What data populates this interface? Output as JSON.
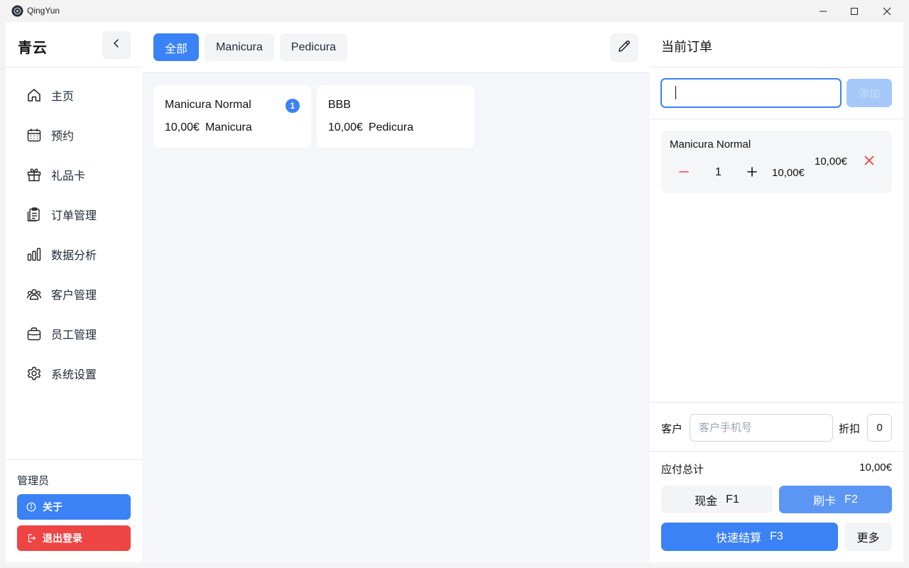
{
  "window": {
    "title": "QingYun"
  },
  "sidebar": {
    "brand": "青云",
    "items": [
      {
        "label": "主页",
        "icon": "home-icon"
      },
      {
        "label": "预约",
        "icon": "calendar-icon"
      },
      {
        "label": "礼品卡",
        "icon": "gift-icon"
      },
      {
        "label": "订单管理",
        "icon": "clipboard-icon"
      },
      {
        "label": "数据分析",
        "icon": "bar-chart-icon"
      },
      {
        "label": "客户管理",
        "icon": "users-icon"
      },
      {
        "label": "员工管理",
        "icon": "briefcase-icon"
      },
      {
        "label": "系统设置",
        "icon": "gear-icon"
      }
    ],
    "role": "管理员",
    "about_label": "关于",
    "logout_label": "退出登录"
  },
  "main": {
    "tabs": [
      {
        "label": "全部",
        "active": true
      },
      {
        "label": "Manicura",
        "active": false
      },
      {
        "label": "Pedicura",
        "active": false
      }
    ],
    "products": [
      {
        "name": "Manicura Normal",
        "price": "10,00€",
        "category": "Manicura",
        "count": "1"
      },
      {
        "name": "BBB",
        "price": "10,00€",
        "category": "Pedicura",
        "count": ""
      }
    ]
  },
  "order": {
    "title": "当前订单",
    "code_value": "",
    "add_label": "添加",
    "items": [
      {
        "name": "Manicura Normal",
        "qty": "1",
        "unit_price": "10,00€",
        "line_total": "10,00€"
      }
    ],
    "customer_label": "客户",
    "customer_placeholder": "客户手机号",
    "discount_label": "折扣",
    "discount_value": "0",
    "total_label": "应付总计",
    "total_value": "10,00€",
    "cash_label": "现金",
    "cash_key": "F1",
    "card_label": "刷卡",
    "card_key": "F2",
    "quick_label": "快速结算",
    "quick_key": "F3",
    "more_label": "更多"
  },
  "colors": {
    "accent": "#3b82f6",
    "danger": "#ef4444",
    "accent_light": "#a5c8f9"
  }
}
